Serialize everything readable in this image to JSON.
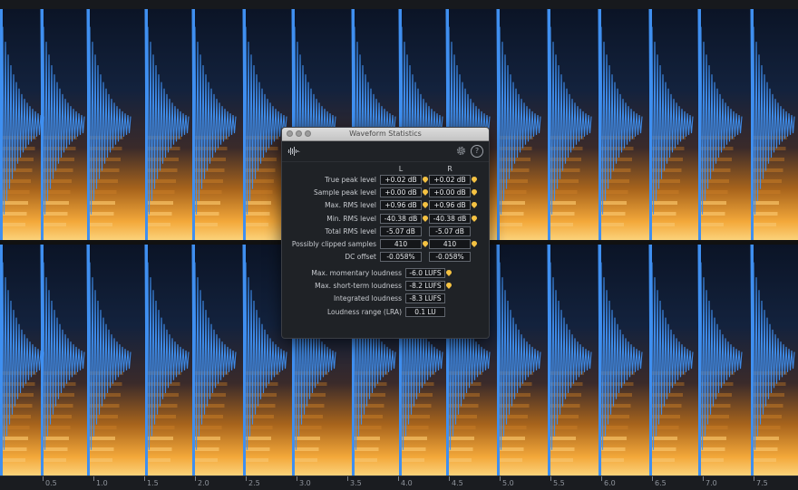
{
  "window": {
    "title": "Waveform Statistics",
    "help_glyph": "?"
  },
  "icons": {
    "logo": "waveform-logo-icon",
    "settings": "gear-icon",
    "help": "help-icon",
    "pin": "peak-marker-icon"
  },
  "colors": {
    "waveform": "#3f8ff0",
    "spectrogram_hot": "#f5a623",
    "panel_bg": "#1f2226",
    "marker": "#f5c242"
  },
  "columns": {
    "left": "L",
    "right": "R"
  },
  "channel_stats": [
    {
      "label": "True peak level",
      "left": "+0.02 dB",
      "right": "+0.02 dB",
      "pin": true
    },
    {
      "label": "Sample peak level",
      "left": "+0.00 dB",
      "right": "+0.00 dB",
      "pin": true
    },
    {
      "label": "Max. RMS level",
      "left": "+0.96 dB",
      "right": "+0.96 dB",
      "pin": true
    },
    {
      "label": "Min. RMS level",
      "left": "-40.38 dB",
      "right": "-40.38 dB",
      "pin": true
    },
    {
      "label": "Total RMS level",
      "left": "-5.07 dB",
      "right": "-5.07 dB",
      "pin": false
    },
    {
      "label": "Possibly clipped samples",
      "left": "410",
      "right": "410",
      "pin": true
    },
    {
      "label": "DC offset",
      "left": "-0.058%",
      "right": "-0.058%",
      "pin": false
    }
  ],
  "loudness_stats": [
    {
      "label": "Max. momentary loudness",
      "value": "-6.0 LUFS",
      "pin": true
    },
    {
      "label": "Max. short-term loudness",
      "value": "-8.2 LUFS",
      "pin": true
    },
    {
      "label": "Integrated loudness",
      "value": "-8.3 LUFS",
      "pin": false
    },
    {
      "label": "Loudness range (LRA)",
      "value": "0.1 LU",
      "pin": false
    }
  ],
  "timeline": {
    "ticks": [
      "0.5",
      "1.0",
      "1.5",
      "2.0",
      "2.5",
      "3.0",
      "3.5",
      "4.0",
      "4.5",
      "5.0",
      "5.5",
      "6.0",
      "6.5",
      "7.0",
      "7.5"
    ]
  }
}
